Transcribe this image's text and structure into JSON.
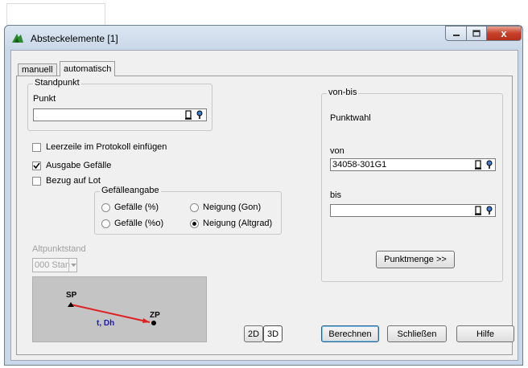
{
  "window": {
    "title": "Absteckelemente [1]",
    "close_glyph": "x"
  },
  "tabs": [
    {
      "label": "manuell"
    },
    {
      "label": "automatisch"
    }
  ],
  "standpunkt": {
    "legend": "Standpunkt",
    "punkt_label": "Punkt",
    "punkt_value": ""
  },
  "options": {
    "leerzeile": {
      "label": "Leerzeile im Protokoll einfügen",
      "checked": false
    },
    "ausgabe_gefaelle": {
      "label": "Ausgabe Gefälle",
      "checked": true
    },
    "bezug_lot": {
      "label": "Bezug auf Lot",
      "checked": false
    }
  },
  "gefaelle": {
    "legend": "Gefälleangabe",
    "radios": [
      {
        "label": "Gefälle (%)",
        "selected": false
      },
      {
        "label": "Neigung (Gon)",
        "selected": false
      },
      {
        "label": "Gefälle (%o)",
        "selected": false
      },
      {
        "label": "Neigung (Altgrad)",
        "selected": true
      }
    ]
  },
  "altpunkt": {
    "label": "Altpunktstand",
    "combo_value": "000  Stan"
  },
  "preview": {
    "sp": "SP",
    "zp": "ZP",
    "mid": "t, Dh"
  },
  "view_buttons": {
    "d2": "2D",
    "d3": "3D"
  },
  "vonbis": {
    "legend": "von-bis",
    "punktwahl": "Punktwahl",
    "von_label": "von",
    "von_value": "34058-301G1",
    "bis_label": "bis",
    "bis_value": "",
    "punktmenge_button": "Punktmenge >>"
  },
  "footer": {
    "berechnen": "Berechnen",
    "schliessen": "Schließen",
    "hilfe": "Hilfe"
  }
}
